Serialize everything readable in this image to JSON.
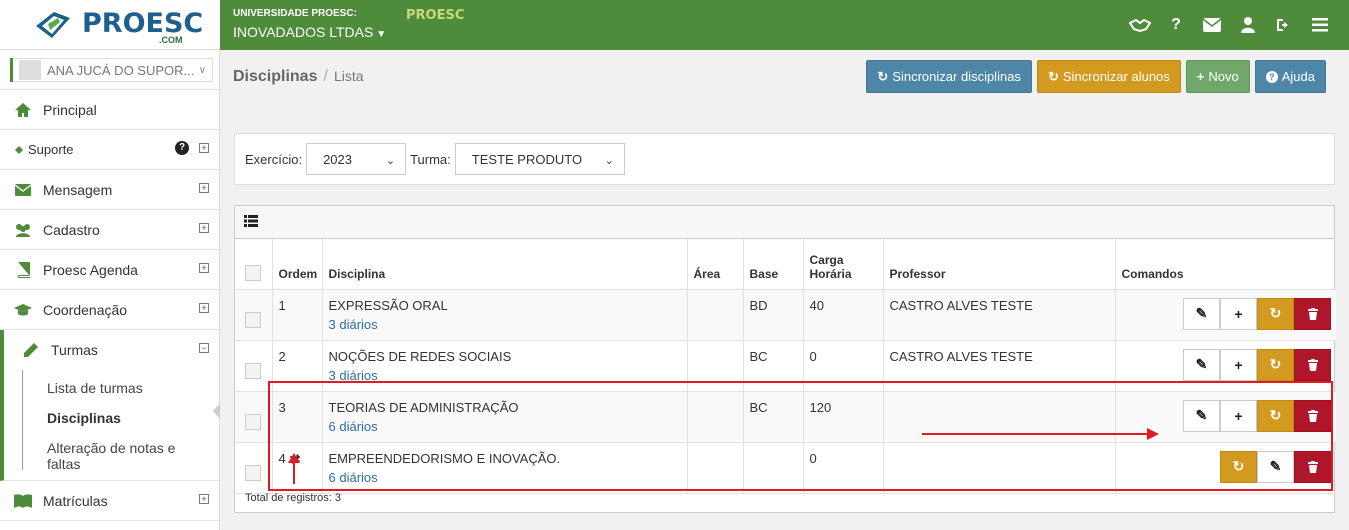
{
  "brand": {
    "logo_text": "PROESC",
    "logo_sub": ".COM",
    "org_label": "UNIVERSIDADE PROESC:",
    "org_name": "INOVADADOS LTDAS",
    "mini_logo": "PROESC",
    "primary_color": "#4e8b3b"
  },
  "topbar": {
    "icons": [
      "handshake-icon",
      "help-icon",
      "envelope-icon",
      "user-icon",
      "sign-out-icon",
      "menu-icon"
    ],
    "help_glyph": "?"
  },
  "sidebar": {
    "user": "ANA JUCÁ DO SUPOR...",
    "items": [
      {
        "label": "Principal",
        "icon": "home-icon"
      },
      {
        "label": "Suporte",
        "icon": "ticket-icon"
      },
      {
        "label": "Mensagem",
        "icon": "envelope-icon"
      },
      {
        "label": "Cadastro",
        "icon": "users-icon"
      },
      {
        "label": "Proesc Agenda",
        "icon": "book-icon"
      },
      {
        "label": "Coordenação",
        "icon": "graduation-cap-icon"
      },
      {
        "label": "Turmas",
        "icon": "pencil-icon"
      },
      {
        "label": "Matrículas",
        "icon": "book-open-icon"
      }
    ],
    "turmas_sub": [
      "Lista de turmas",
      "Disciplinas",
      "Alteração de notas e faltas"
    ]
  },
  "breadcrumb": {
    "title": "Disciplinas",
    "current": "Lista"
  },
  "actions": {
    "sync_disciplinas": "Sincronizar disciplinas",
    "sync_alunos": "Sincronizar alunos",
    "novo": "Novo",
    "ajuda": "Ajuda"
  },
  "filters": {
    "exercicio_label": "Exercício:",
    "exercicio_value": "2023",
    "turma_label": "Turma:",
    "turma_value": "TESTE PRODUTO"
  },
  "table": {
    "headers": {
      "ordem": "Ordem",
      "disciplina": "Disciplina",
      "area": "Área",
      "base": "Base",
      "carga_line1": "Carga",
      "carga_line2": "Horária",
      "professor": "Professor",
      "comandos": "Comandos"
    },
    "rows": [
      {
        "ordem": "1",
        "disciplina": "EXPRESSÃO ORAL",
        "diarios": "3 diários",
        "area": "",
        "base": "BD",
        "carga": "40",
        "professor": "CASTRO ALVES TESTE"
      },
      {
        "ordem": "2",
        "disciplina": "NOÇÕES DE REDES SOCIAIS",
        "diarios": "3 diários",
        "area": "",
        "base": "BC",
        "carga": "0",
        "professor": "CASTRO ALVES TESTE"
      },
      {
        "ordem": "3",
        "disciplina": "TEORIAS DE ADMINISTRAÇÃO",
        "diarios": "6 diários",
        "area": "",
        "base": "BC",
        "carga": "120",
        "professor": ""
      },
      {
        "ordem": "4",
        "disciplina": "EMPREENDEDORISMO E INOVAÇÃO.",
        "diarios": "6 diários",
        "area": "",
        "base": "",
        "carga": "0",
        "professor": ""
      }
    ],
    "total": "Total de registros: 3"
  }
}
